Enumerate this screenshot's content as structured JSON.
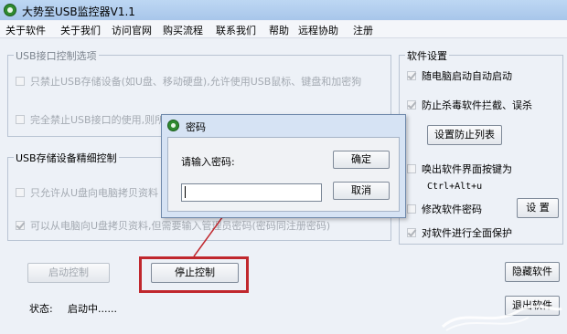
{
  "window": {
    "title": "大势至USB监控器V1.1"
  },
  "menu": [
    "关于软件",
    "关于我们",
    "访问官网",
    "购买流程",
    "联系我们",
    "帮助",
    "远程协助",
    "注册"
  ],
  "usb_port_group": {
    "title": "USB接口控制选项",
    "options": [
      {
        "label": "只禁止USB存储设备(如U盘、移动硬盘),允许使用USB鼠标、键盘和加密狗",
        "checked": false
      },
      {
        "label": "完全禁止USB接口的使用,则所",
        "checked": false
      }
    ]
  },
  "storage_group": {
    "title": "USB存储设备精细控制",
    "options": [
      {
        "label": "只允许从U盘向电脑拷贝资料",
        "checked": false
      },
      {
        "label": "可以从电脑向U盘拷贝资料,但需要输入管理员密码(密码同注册密码)",
        "checked": true
      }
    ]
  },
  "software_settings": {
    "title": "软件设置",
    "autostart_label": "随电脑启动自动启动",
    "anti_kill_label": "防止杀毒软件拦截、误杀",
    "set_prevent_list_button": "设置防止列表",
    "hotkey_label": "唤出软件界面按键为",
    "hotkey_value": "Ctrl+Alt+u",
    "modify_password_label": "修改软件密码",
    "modify_password_button": "设 置",
    "full_protect_label": "对软件进行全面保护"
  },
  "controls": {
    "start_button": "启动控制",
    "stop_button": "停止控制",
    "hide_button": "隐藏软件",
    "exit_button": "退出软件"
  },
  "status": {
    "label": "状态:",
    "value": "启动中......"
  },
  "password_dialog": {
    "title": "密码",
    "prompt": "请输入密码:",
    "input_value": "",
    "ok_button": "确定",
    "cancel_button": "取消"
  },
  "colors": {
    "annotation": "#c0272d",
    "title_gradient_top": "#bdd7f3"
  }
}
